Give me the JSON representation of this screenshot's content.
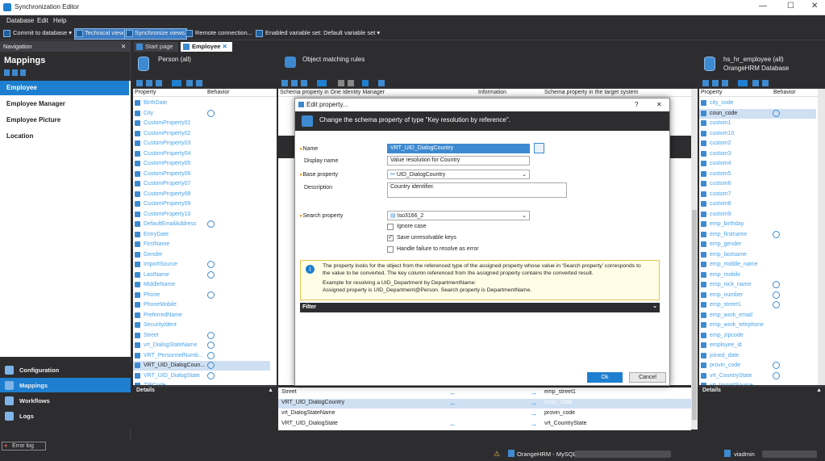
{
  "window": {
    "title": "Synchronization Editor",
    "min": "—",
    "max": "☐",
    "close": "✕"
  },
  "menu": [
    "Database",
    "Edit",
    "Help"
  ],
  "toolbar": {
    "commit": "Commit to database",
    "technical": "Technical view",
    "synchronize": "Synchronize views",
    "remote": "Remote connection...",
    "varset": "Enabled variable set: Default variable set"
  },
  "nav": {
    "header": "Navigation",
    "title": "Mappings",
    "items": [
      "Employee",
      "Employee Manager",
      "Employee Picture",
      "Location"
    ],
    "bottom": [
      "Configuration",
      "Mappings",
      "Workflows",
      "Logs"
    ]
  },
  "tabs": [
    "Start page",
    "Employee"
  ],
  "left_pane": {
    "title": "Person (all)",
    "col_property": "Property",
    "col_behavior": "Behavior",
    "details": "Details",
    "rows": [
      "BirthDate",
      "City",
      "CustomProperty01",
      "CustomProperty02",
      "CustomProperty03",
      "CustomProperty04",
      "CustomProperty05",
      "CustomProperty06",
      "CustomProperty07",
      "CustomProperty08",
      "CustomProperty09",
      "CustomProperty10",
      "DefaultEmailAddress",
      "EntryDate",
      "FirstName",
      "Gender",
      "ImportSource",
      "LastName",
      "MiddleName",
      "Phone",
      "PhoneMobile",
      "PreferredName",
      "SecurityIdent",
      "Street",
      "vrt_DialogStateName",
      "VRT_PersonnelNumb...",
      "VRT_UID_DialogCoun...",
      "VRT_UID_DialogState",
      "ZIPCode"
    ]
  },
  "middle_pane": {
    "title": "Object matching rules",
    "col1": "Schema property in One Identity Manager",
    "col2": "Information",
    "col3": "Schema property in the target system",
    "rows": [
      {
        "l": "Street",
        "r": "emp_street1"
      },
      {
        "l": "VRT_UID_DialogCountry",
        "r": "coun_code"
      },
      {
        "l": "vrt_DialogStateName",
        "r": "provin_code"
      },
      {
        "l": "VRT_UID_DialogState",
        "r": "vrt_CountryState"
      }
    ]
  },
  "right_pane": {
    "title": "hs_hr_employee (all)",
    "subtitle": "OrangeHRM Database",
    "col_property": "Property",
    "col_behavior": "Behavior",
    "details": "Details",
    "rows": [
      "city_code",
      "coun_code",
      "custom1",
      "custom10",
      "custom2",
      "custom3",
      "custom4",
      "custom5",
      "custom6",
      "custom7",
      "custom8",
      "custom9",
      "emp_birthday",
      "emp_firstname",
      "emp_gender",
      "emp_lastname",
      "emp_middle_name",
      "emp_mobile",
      "emp_nick_name",
      "emp_number",
      "emp_street1",
      "emp_work_email",
      "emp_work_telephone",
      "emp_zipcode",
      "employee_id",
      "joined_date",
      "provin_code",
      "vrt_CountryState",
      "vrt_ImportSource"
    ]
  },
  "dialog": {
    "title": "Edit property...",
    "help": "?",
    "close": "✕",
    "header": "Change the schema property of type \"Key resolution by reference\".",
    "name_label": "Name",
    "name": "VRT_UID_DialogCountry",
    "display_label": "Display name",
    "display": "Value resolution for Country",
    "base_label": "Base property",
    "base": "UID_DialogCountry",
    "desc_label": "Description",
    "desc": "Country identifier.",
    "search_label": "Search property",
    "search": "Iso3166_2",
    "ignore_case": "Ignore case",
    "save_unres": "Save unresolvable keys",
    "handle_fail": "Handle failure to resolve as error",
    "info1": "The property looks for the object from the referenced type of the assigned property whose value in 'Search property' corresponds to",
    "info2": "the value to be converted. The key column referenced from the assigned property contains the converted result.",
    "info3": "Example for resolving a UID_Department by DepartmentName:",
    "info4": "Assigned property is UID_Department@Person. Search property is DepartmentName.",
    "filter": "Filter",
    "ok": "Ok",
    "cancel": "Cancel"
  },
  "status": {
    "errorlog": "Error log",
    "connection": "OrangeHRM - MySQL",
    "user": "viadmin"
  }
}
